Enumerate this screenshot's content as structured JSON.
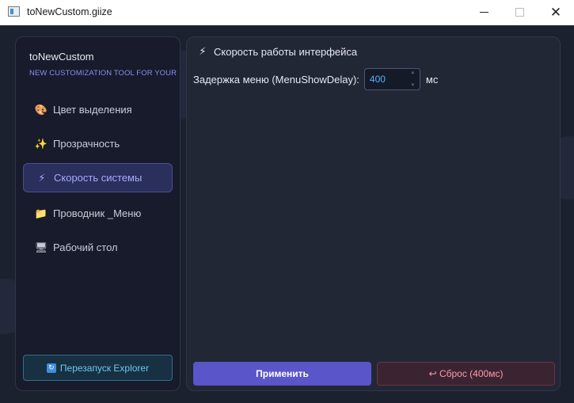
{
  "window": {
    "title": "toNewCustom.giize"
  },
  "sidebar": {
    "brand_name": "toNewCustom",
    "brand_tagline": "NEW CUSTOMIZATION TOOL FOR YOUR",
    "items": [
      {
        "label": "Цвет выделения",
        "icon": "🎨",
        "icon_name": "palette-icon",
        "active": false
      },
      {
        "label": "Прозрачность",
        "icon": "✨",
        "icon_name": "sparkles-icon",
        "active": false
      },
      {
        "label": "Скорость системы",
        "icon": "⚡",
        "icon_name": "lightning-icon",
        "active": true
      },
      {
        "label": "Проводник _Меню",
        "icon": "📁",
        "icon_name": "folder-icon",
        "active": false
      },
      {
        "label": "Рабочий стол",
        "icon": "🖥",
        "icon_name": "monitor-icon",
        "active": false
      }
    ],
    "restart_button": {
      "label": "Перезапуск Explorer",
      "icon": "↻",
      "icon_name": "refresh-icon"
    }
  },
  "main": {
    "section_icon": "⚡",
    "section_title": "Скорость работы интерфейса",
    "menu_delay": {
      "label": "Задержка меню (MenuShowDelay):",
      "value": "400",
      "unit": "мс"
    },
    "apply_label": "Применить",
    "reset_label": "↩ Сброс (400мс)"
  },
  "colors": {
    "accent": "#5a55c8",
    "active_nav_bg": "#2a2f5c",
    "tagline": "#8a8df0",
    "input_text": "#4fb2ff",
    "danger_text": "#ff9aa8"
  }
}
